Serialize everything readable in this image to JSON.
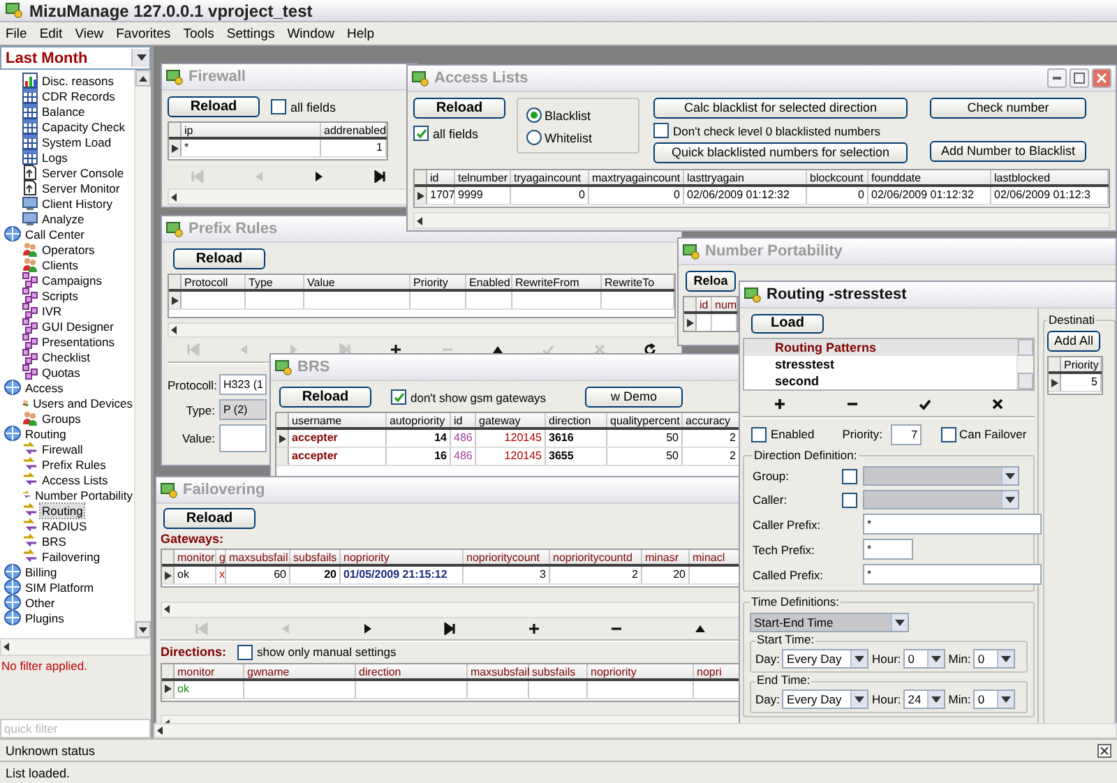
{
  "window": {
    "title": "MizuManage 127.0.0.1 vproject_test"
  },
  "menu": [
    "File",
    "Edit",
    "View",
    "Favorites",
    "Tools",
    "Settings",
    "Window",
    "Help"
  ],
  "sidebar": {
    "period": "Last Month",
    "continued_items": [
      {
        "label": "Disc. reasons",
        "kind": "chart",
        "selected": false
      },
      {
        "label": "CDR Records",
        "kind": "grid",
        "selected": false
      },
      {
        "label": "Balance",
        "kind": "grid",
        "selected": false
      },
      {
        "label": "Capacity Check",
        "kind": "grid",
        "selected": false
      },
      {
        "label": "System Load",
        "kind": "grid",
        "selected": false
      },
      {
        "label": "Logs",
        "kind": "grid",
        "selected": false
      },
      {
        "label": "Server Console",
        "kind": "console",
        "selected": false
      },
      {
        "label": "Server Monitor",
        "kind": "console",
        "selected": false
      },
      {
        "label": "Client History",
        "kind": "history",
        "selected": false
      },
      {
        "label": "Analyze",
        "kind": "history",
        "selected": false
      }
    ],
    "groups": [
      {
        "label": "Call Center",
        "kind": "group",
        "selected": false,
        "children": [
          {
            "label": "Operators",
            "kind": "people",
            "selected": false
          },
          {
            "label": "Clients",
            "kind": "people",
            "selected": false
          },
          {
            "label": "Campaigns",
            "kind": "module",
            "selected": false
          },
          {
            "label": "Scripts",
            "kind": "module",
            "selected": false
          },
          {
            "label": "IVR",
            "kind": "module",
            "selected": false
          },
          {
            "label": "GUI Designer",
            "kind": "module",
            "selected": false
          },
          {
            "label": "Presentations",
            "kind": "module",
            "selected": false
          },
          {
            "label": "Checklist",
            "kind": "module",
            "selected": false
          },
          {
            "label": "Quotas",
            "kind": "module",
            "selected": false
          }
        ]
      },
      {
        "label": "Access",
        "kind": "group",
        "selected": false,
        "children": [
          {
            "label": "Users and Devices",
            "kind": "people",
            "selected": false
          },
          {
            "label": "Groups",
            "kind": "people",
            "selected": false
          }
        ]
      },
      {
        "label": "Routing",
        "kind": "group",
        "selected": false,
        "children": [
          {
            "label": "Firewall",
            "kind": "route",
            "selected": false
          },
          {
            "label": "Prefix Rules",
            "kind": "route",
            "selected": false
          },
          {
            "label": "Access Lists",
            "kind": "route",
            "selected": false
          },
          {
            "label": "Number Portability",
            "kind": "route",
            "selected": false
          },
          {
            "label": "Routing",
            "kind": "route",
            "selected": true
          },
          {
            "label": "RADIUS",
            "kind": "route",
            "selected": false
          },
          {
            "label": "BRS",
            "kind": "route",
            "selected": false
          },
          {
            "label": "Failovering",
            "kind": "route",
            "selected": false
          }
        ]
      },
      {
        "label": "Billing",
        "kind": "group",
        "selected": false
      },
      {
        "label": "SIM Platform",
        "kind": "group",
        "selected": false
      },
      {
        "label": "Other",
        "kind": "group",
        "selected": false
      },
      {
        "label": "Plugins",
        "kind": "group",
        "selected": false
      }
    ],
    "filter_status": "No filter applied.",
    "quick_filter": {
      "placeholder": "quick filter"
    }
  },
  "firewall": {
    "title": "Firewall",
    "active": false,
    "reload": "Reload",
    "all_fields": {
      "label": "all fields",
      "checked": false
    },
    "table": {
      "columns": [
        "ip",
        "addrenabled"
      ],
      "rows": [
        {
          "current": true,
          "cells": [
            "*",
            "1"
          ]
        }
      ]
    },
    "navigator": [
      {
        "kind": "first",
        "disabled": true
      },
      {
        "kind": "prev",
        "disabled": true
      },
      {
        "kind": "next",
        "disabled": false
      },
      {
        "kind": "last",
        "disabled": false
      }
    ]
  },
  "access_lists": {
    "title": "Access Lists",
    "active": false,
    "reload": "Reload",
    "all_fields": {
      "label": "all fields",
      "checked": true
    },
    "list_type": [
      {
        "label": "Blacklist",
        "selected": true
      },
      {
        "label": "Whitelist",
        "selected": false
      }
    ],
    "calc_button": "Calc blacklist for selected direction",
    "skip_level0": {
      "label": "Don't check level 0 blacklisted numbers",
      "checked": false
    },
    "quick_button": "Quick blacklisted numbers for selection",
    "check_button": "Check number",
    "add_button": "Add Number to Blacklist",
    "table": {
      "columns": [
        "id",
        "telnumber",
        "tryagaincount",
        "maxtryagaincount",
        "lasttryagain",
        "blockcount",
        "founddate",
        "lastblocked"
      ],
      "rows": [
        {
          "current": true,
          "cells": [
            "1707",
            "9999",
            "0",
            "0",
            "02/06/2009 01:12:32",
            "0",
            "02/06/2009 01:12:32",
            "02/06/2009 01:12:3"
          ]
        }
      ]
    }
  },
  "prefix_rules": {
    "title": "Prefix Rules",
    "active": false,
    "reload": "Reload",
    "table": {
      "columns": [
        "Protocoll",
        "Type",
        "Value",
        "Priority",
        "Enabled",
        "RewriteFrom",
        "RewriteTo"
      ],
      "rows": [
        {
          "current": true
        }
      ]
    },
    "navigator": [
      {
        "kind": "first",
        "disabled": true
      },
      {
        "kind": "prev",
        "disabled": true
      },
      {
        "kind": "next",
        "disabled": true
      },
      {
        "kind": "last",
        "disabled": true
      },
      {
        "kind": "add",
        "disabled": false
      },
      {
        "kind": "remove",
        "disabled": true
      },
      {
        "kind": "up",
        "disabled": false
      },
      {
        "kind": "check",
        "disabled": true
      },
      {
        "kind": "cancel",
        "disabled": true
      },
      {
        "kind": "refresh",
        "disabled": false
      }
    ],
    "form": [
      {
        "label": "Protocoll:",
        "value": "H323 (1"
      },
      {
        "label": "Type:",
        "value": "P (2)"
      },
      {
        "label": "Value:"
      }
    ]
  },
  "number_portability": {
    "title": "Number Portability",
    "active": false,
    "reload": "Reloa",
    "table": {
      "columns": [
        "id",
        "num"
      ],
      "rows": [
        {
          "current": true
        }
      ]
    }
  },
  "brs": {
    "title": "BRS",
    "active": false,
    "reload": "Reload",
    "hide_gsm": {
      "label": "don't show gsm gateways",
      "checked": true
    },
    "demo_button": "w Demo",
    "table": {
      "columns": [
        "username",
        "autopriority",
        "id",
        "gateway",
        "direction",
        "qualitypercent",
        "accuracy"
      ],
      "rows": [
        {
          "current": true,
          "cells": [
            "accepter",
            "14",
            "486",
            "120145",
            "3616",
            "50",
            "2"
          ]
        },
        {
          "current": false,
          "cells": [
            "accepter",
            "16",
            "486",
            "120145",
            "3655",
            "50",
            "2"
          ]
        }
      ]
    }
  },
  "failovering": {
    "title": "Failovering",
    "active": false,
    "reload": "Reload",
    "gateways": {
      "label": "Gateways:",
      "table": {
        "columns": [
          "monitor",
          "g",
          "maxsubsfail",
          "subsfails",
          "nopriority",
          "noprioritycount",
          "noprioritycountd",
          "minasr",
          "minacl"
        ],
        "rows": [
          {
            "current": true,
            "cells": [
              "ok",
              "x",
              "60",
              "20",
              "01/05/2009 21:15:12",
              "3",
              "2",
              "20"
            ]
          }
        ]
      }
    },
    "navigator": [
      {
        "kind": "first",
        "disabled": true
      },
      {
        "kind": "prev",
        "disabled": true
      },
      {
        "kind": "next",
        "disabled": false
      },
      {
        "kind": "last",
        "disabled": false
      },
      {
        "kind": "add",
        "disabled": false
      },
      {
        "kind": "remove",
        "disabled": false
      },
      {
        "kind": "up",
        "disabled": false
      }
    ],
    "directions": {
      "label": "Directions:",
      "manual_only": {
        "label": "show only manual settings",
        "checked": false
      },
      "table": {
        "columns": [
          "monitor",
          "gwname",
          "direction",
          "maxsubsfail",
          "subsfails",
          "nopriority",
          "nopri"
        ],
        "rows": [
          {
            "current": true,
            "cells": [
              "ok"
            ]
          }
        ]
      }
    }
  },
  "routing": {
    "title": "Routing -stresstest",
    "active": true,
    "load": "Load",
    "patterns": [
      {
        "label": "Routing Patterns",
        "selected": true
      },
      {
        "label": "stresstest",
        "selected": false
      },
      {
        "label": "second",
        "selected": false
      }
    ],
    "enabled": {
      "label": "Enabled",
      "checked": false
    },
    "priority": {
      "label": "Priority:",
      "value": "7"
    },
    "can_failover": {
      "label": "Can Failover",
      "checked": false
    },
    "direction_definition": {
      "title": "Direction Definition:",
      "group": {
        "label": "Group:",
        "checked": false
      },
      "caller": {
        "label": "Caller:",
        "checked": false
      },
      "prefixes": [
        {
          "label": "Caller Prefix:",
          "value": "*",
          "kind": "wide"
        },
        {
          "label": "Tech Prefix:",
          "value": "*",
          "kind": "short"
        },
        {
          "label": "Called Prefix:",
          "value": "*",
          "kind": "wide"
        }
      ]
    },
    "time_definitions": {
      "title": "Time Definitions:",
      "mode": "Start-End Time",
      "ranges": [
        {
          "title": "Start Time:",
          "day_label": "Day:",
          "day": "Every Day",
          "hour_label": "Hour:",
          "hour": "0",
          "min_label": "Min:",
          "min": "0"
        },
        {
          "title": "End Time:",
          "day_label": "Day:",
          "day": "Every Day",
          "hour_label": "Hour:",
          "hour": "24",
          "min_label": "Min:",
          "min": "0"
        }
      ]
    },
    "destinations": {
      "title": "Destinati",
      "add_all": "Add All",
      "table": {
        "columns": [
          "Priority"
        ],
        "rows": [
          {
            "current": true,
            "cells": [
              "5"
            ]
          }
        ]
      }
    }
  },
  "status_bar": [
    "Unknown status",
    "List loaded."
  ]
}
